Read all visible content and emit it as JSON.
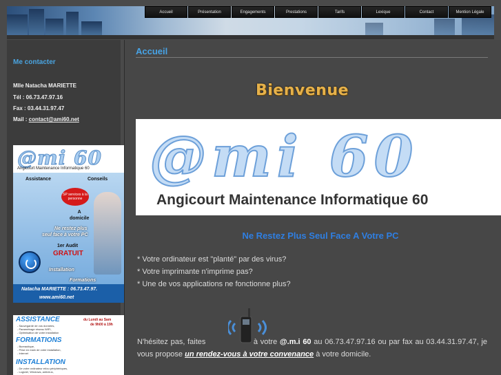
{
  "nav": [
    "Accueil",
    "Présentation",
    "Engagements",
    "Prestations",
    "Tarifs",
    "Lexique",
    "Contact",
    "Mention Légale"
  ],
  "sidebar": {
    "title": "Me contacter",
    "name": "Mlle Natacha MARIETTE",
    "tel": "Tél : 06.73.47.97.16",
    "fax": "Fax : 03.44.31.97.47",
    "mail_label": "Mail : ",
    "mail": "contact@ami60.net"
  },
  "promo1": {
    "logo": "@mi 60",
    "subtitle": "Angicourt Maintenance Informatique 60",
    "assistance": "Assistance",
    "conseils": "Conseils",
    "badge": "SP services à la personne",
    "a_domicile": "A\ndomicile",
    "ne_restez": "Ne restez plus",
    "seul_face": "seul face à votre PC",
    "audit": "1er Audit",
    "gratuit": "GRATUIT",
    "installation": "Installation",
    "formations": "Formations",
    "footer_name": "Natacha MARIETTE : 06.73.47.97.",
    "footer_url": "www.ami60.net"
  },
  "promo2": {
    "assistance": "ASSISTANCE",
    "assistance_lines": [
      "- Sauvegarde de vos données,",
      "- Paramétrage réseau WIFI,",
      "- Optimisation de votre installation"
    ],
    "days": "du Lundi au Sam",
    "hours": "de 9h00 à 19h",
    "formations": "FORMATIONS",
    "formations_lines": [
      "- Bureautique,",
      "- Prise en main de votre installation,",
      "- Internet"
    ],
    "installation": "INSTALLATION",
    "installation_lines": [
      "- De votre ordinateur et/ou périphériques,",
      "- Logiciel, Windows, antivirus,"
    ]
  },
  "content": {
    "page_title": "Accueil",
    "welcome": "Bienvenue",
    "banner_logo": "@mi 60",
    "banner_line": "Angicourt Maintenance Informatique 60",
    "tagline": "Ne Restez Plus Seul Face A Votre PC",
    "questions": [
      "* Votre ordinateur est \"planté\" par des virus?",
      "* Votre imprimante n'imprime pas?",
      "* Une de vos applications ne fonctionne plus?"
    ],
    "para_start": "N'hésitez pas, faites",
    "para_mid": "à votre",
    "para_brand": "@.m.i 60",
    "para_after": "au 06.73.47.97.16 ou par fax au 03.44.31.97.47, je vous propose",
    "para_link": "un rendez-vous à votre convenance",
    "para_end": "à votre domicile."
  }
}
